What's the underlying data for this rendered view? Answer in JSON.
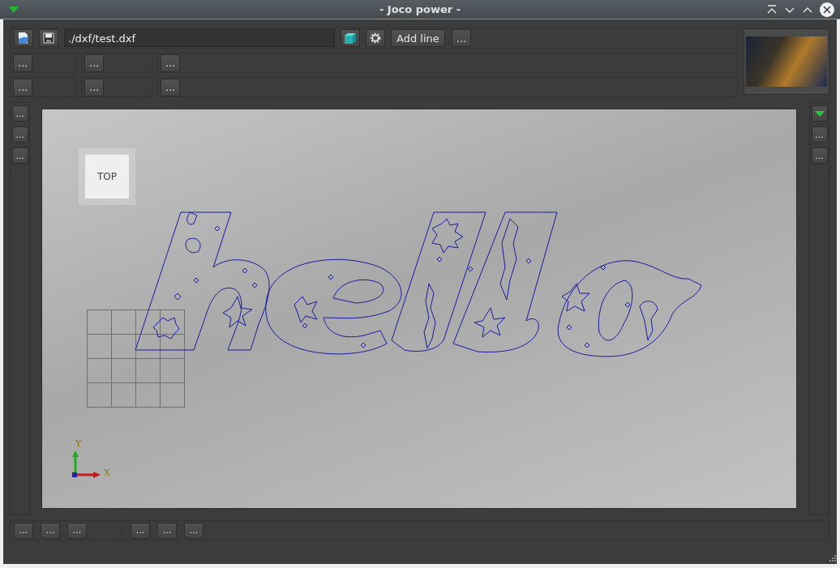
{
  "window": {
    "title": "- Joco power -"
  },
  "toolbar": {
    "file_path": "./dxf/test.dxf",
    "buttons": [
      "Add line",
      "..."
    ]
  },
  "button_rows": [
    [
      "...",
      "...",
      "..."
    ],
    [
      "...",
      "...",
      "..."
    ]
  ],
  "left_buttons": [
    "...",
    "...",
    "..."
  ],
  "right_buttons": [
    "...",
    "..."
  ],
  "viewport": {
    "view_label": "TOP",
    "axis_labels": {
      "y": "Y",
      "x": "X"
    }
  },
  "bottom_groups": [
    [
      "...",
      "...",
      "..."
    ],
    [
      "...",
      "...",
      "..."
    ]
  ]
}
